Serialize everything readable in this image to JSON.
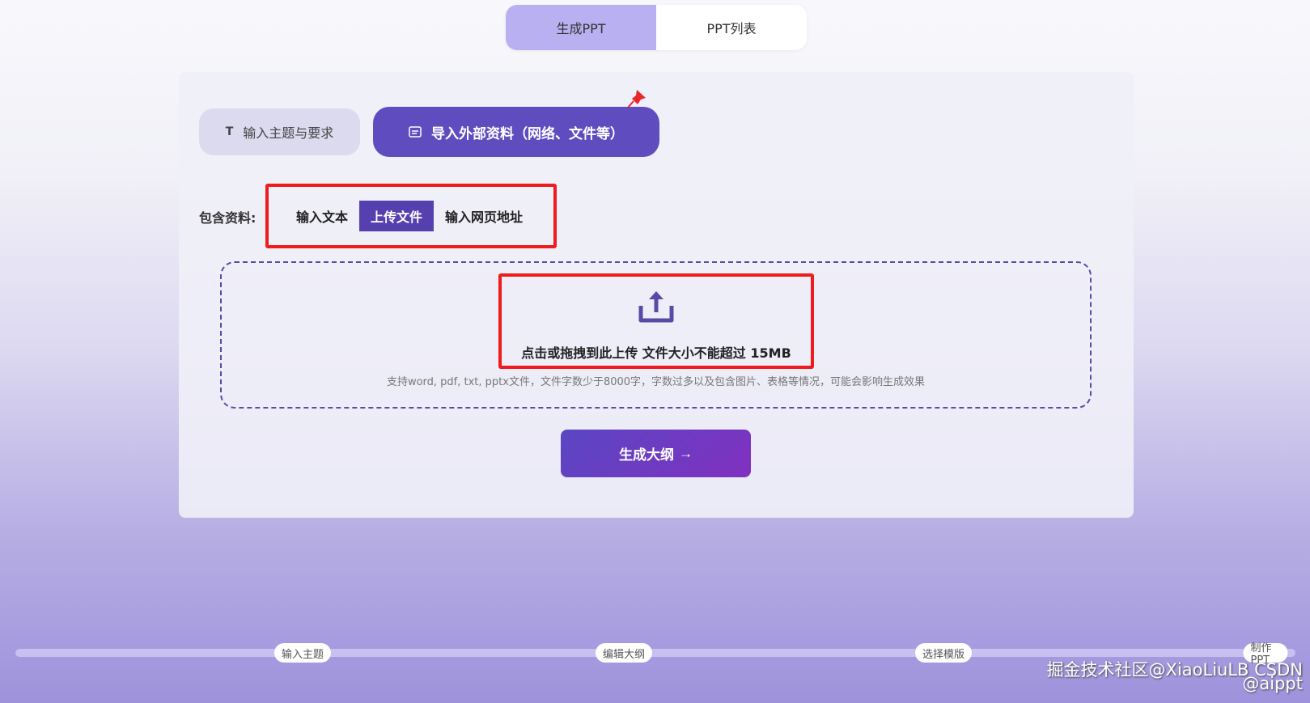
{
  "top_tabs": [
    {
      "label": "生成PPT",
      "active": true
    },
    {
      "label": "PPT列表",
      "active": false
    }
  ],
  "modes": {
    "topic": {
      "icon": "T",
      "label": "输入主题与要求"
    },
    "import": {
      "label": "导入外部资料（网络、文件等）"
    }
  },
  "source": {
    "label": "包含资料:",
    "options": [
      "输入文本",
      "上传文件",
      "输入网页地址"
    ],
    "selected": "上传文件"
  },
  "upload": {
    "main_text": "点击或拖拽到此上传 文件大小不能超过 15MB",
    "hint": "支持word, pdf, txt, pptx文件，文件字数少于8000字，字数过多以及包含图片、表格等情况，可能会影响生成效果"
  },
  "generate": {
    "label": "生成大纲",
    "arrow": "→"
  },
  "steps": [
    "输入主题",
    "编辑大纲",
    "选择模版",
    "制作PPT"
  ],
  "watermark": "掘金技术社区@XiaoLiuLB CSDN @aippt",
  "colors": {
    "accent": "#5f4dc0",
    "highlight": "#ee1c1c"
  }
}
